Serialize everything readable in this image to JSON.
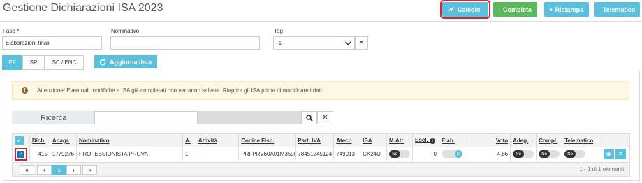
{
  "page": {
    "title": "Gestione Dichiarazioni ISA 2023"
  },
  "toolbar": {
    "calcolo_label": "Calcolo",
    "completa_label": "Completa",
    "ristampa_label": "Ristampa",
    "telematico_label": "Telematico"
  },
  "filters": {
    "fase_label": "Fase",
    "fase_required": "*",
    "fase_value": "Elaborazioni finali",
    "nominativo_label": "Nominativo",
    "nominativo_value": "",
    "tag_label": "Tag",
    "tag_value": "-1"
  },
  "tabs": [
    {
      "label": "PF",
      "active": true
    },
    {
      "label": "SP",
      "active": false
    },
    {
      "label": "SC / ENC",
      "active": false
    }
  ],
  "aggiorna_label": "Aggiorna lista",
  "alert": {
    "text": "Attenzione! Eventuali modifiche a ISA già completati non verranno salvate. Riaprire gli ISA prima di modificare i dati."
  },
  "search": {
    "label": "Ricerca",
    "value": ""
  },
  "table": {
    "headers": [
      "Dich.",
      "Anagr.",
      "Nominativo",
      "A.",
      "Attività",
      "Codice Fisc.",
      "Part. IVA",
      "Ateco",
      "ISA",
      "M.Att.",
      "Escl.",
      "Elab.",
      "Voto",
      "Adeg.",
      "Compl.",
      "Telematico"
    ],
    "rows": [
      {
        "dich": "415",
        "anagr": "1779276",
        "nominativo": "PROFESSIONISTA PROVA",
        "a": "1",
        "attivita": "",
        "codice_fisc": "PRFPRV60A01M359I",
        "part_iva": "78451245124",
        "ateco": "749013",
        "isa": "CK24U",
        "m_att": "No",
        "escl": "0",
        "elab": "Si",
        "voto": "4,86",
        "adeg": "No",
        "compl": "No",
        "telematico": "No"
      }
    ]
  },
  "pager": {
    "first": "«",
    "prev": "‹",
    "page": "1",
    "next": "›",
    "last": "»",
    "info": "1 - 1 di 1 elementi"
  },
  "colors": {
    "accent": "#5bc0de",
    "success": "#5cb85c",
    "highlight": "#d9232d"
  }
}
